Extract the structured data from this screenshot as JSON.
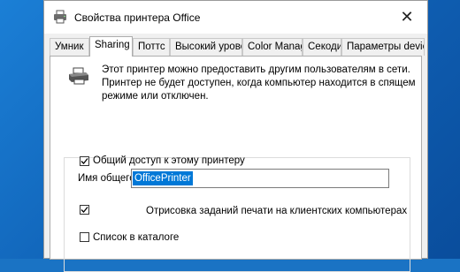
{
  "window": {
    "title": "Свойства принтера Office",
    "close_glyph": "✕"
  },
  "tabs": [
    {
      "label": "Умник",
      "active": false
    },
    {
      "label": "Sharing",
      "active": true
    },
    {
      "label": "Поттс",
      "active": false
    },
    {
      "label": "Высокий уровень",
      "active": false
    },
    {
      "label": "Color Management",
      "active": false
    },
    {
      "label": "Секоди",
      "active": false
    },
    {
      "label": "Параметры device",
      "active": false
    }
  ],
  "sharing": {
    "description": "Этот принтер можно предоставить другим пользователям в сети. Принтер не будет доступен, когда компьютер находится в спящем режиме или отключен.",
    "share_checkbox": {
      "label": "Общий доступ к этому принтеру",
      "checked": true
    },
    "share_name": {
      "label": "Имя общего ресурса",
      "value": "OfficePrinter"
    },
    "render_checkbox": {
      "label": "Отрисовка заданий печати на клиентских компьютерах",
      "checked": true
    },
    "list_checkbox": {
      "label": "Список в каталоге",
      "checked": false
    }
  },
  "colors": {
    "desktop": "#1a73c4",
    "selection": "#0078d7"
  },
  "icons": {
    "title": "printer-icon",
    "panel": "printer-icon",
    "close": "close-icon",
    "check": "checkmark-icon"
  }
}
